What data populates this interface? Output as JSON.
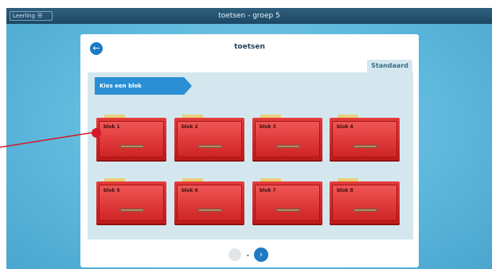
{
  "topbar": {
    "pupil_label": "Leerling",
    "menu_icon": "☰",
    "title": "toetsen - groep 5"
  },
  "panel": {
    "title": "toetsen",
    "back_icon": "←",
    "standard_tab": "Standaard",
    "banner": "Kies een blok",
    "blocks": [
      {
        "label": "blok 1"
      },
      {
        "label": "blok 2"
      },
      {
        "label": "blok 3"
      },
      {
        "label": "blok 4"
      },
      {
        "label": "blok 5"
      },
      {
        "label": "blok 6"
      },
      {
        "label": "blok 7"
      },
      {
        "label": "blok 8"
      }
    ],
    "pager": {
      "separator": "•",
      "next_icon": "›"
    }
  },
  "colors": {
    "topbar": "#1d4764",
    "accent_blue": "#1c7bc4",
    "drawer_red": "#d42a2a",
    "annotation_red": "#d41a2a"
  }
}
